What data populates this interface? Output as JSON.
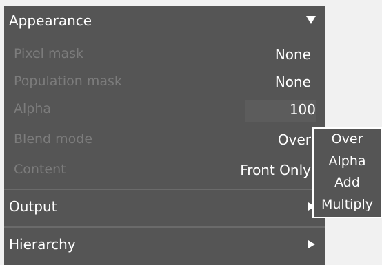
{
  "appearance": {
    "title": "Appearance",
    "rows": [
      {
        "label": "Pixel mask",
        "value": "None"
      },
      {
        "label": "Population mask",
        "value": "None"
      },
      {
        "label": "Alpha",
        "value": "100"
      },
      {
        "label": "Blend mode",
        "value": "Over"
      },
      {
        "label": "Content",
        "value": "Front Only"
      }
    ]
  },
  "output": {
    "title": "Output"
  },
  "hierarchy": {
    "title": "Hierarchy"
  },
  "blend_dropdown": {
    "options": [
      "Over",
      "Alpha",
      "Add",
      "Multiply"
    ]
  },
  "colors": {
    "panel_bg": "#555555",
    "label_disabled": "#7c7c7c",
    "text": "#ffffff",
    "page_bg": "#f1f1f1"
  },
  "icons": {
    "expanded": "triangle-down-icon",
    "collapsed": "triangle-right-icon"
  }
}
